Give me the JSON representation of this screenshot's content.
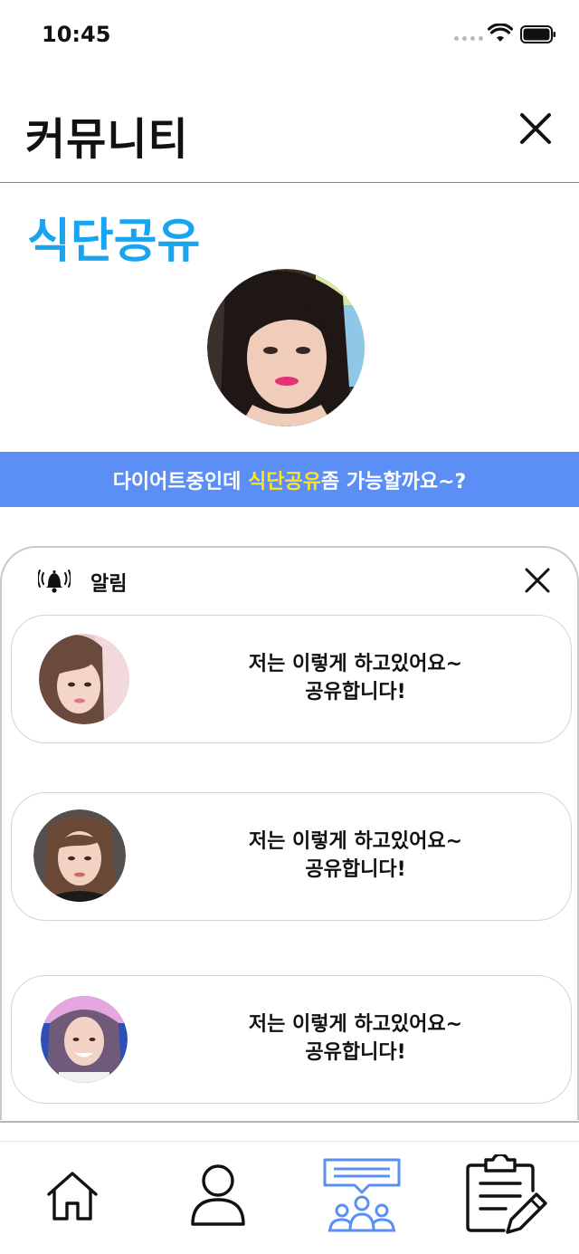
{
  "status_bar": {
    "time": "10:45"
  },
  "header": {
    "title": "커뮤니티"
  },
  "section": {
    "title": "식단공유"
  },
  "banner": {
    "text_before": "다이어트중인데 ",
    "highlight": "식단공유",
    "text_after": "좀 가능할까요~?"
  },
  "notifications": {
    "label": "알림",
    "items": [
      {
        "line1": "저는 이렇게 하고있어요~",
        "line2": "공유합니다!"
      },
      {
        "line1": "저는 이렇게 하고있어요~",
        "line2": "공유합니다!"
      },
      {
        "line1": "저는 이렇게 하고있어요~",
        "line2": "공유합니다!"
      }
    ]
  },
  "bottom_nav": {
    "items": [
      {
        "icon": "home-icon",
        "active": false
      },
      {
        "icon": "profile-icon",
        "active": false
      },
      {
        "icon": "community-icon",
        "active": true
      },
      {
        "icon": "clipboard-edit-icon",
        "active": false
      }
    ]
  },
  "colors": {
    "accent_blue": "#5b8ff6",
    "title_blue": "#1aa3ef",
    "highlight_yellow": "#ffe227",
    "divider_blue": "#5b86e8"
  }
}
